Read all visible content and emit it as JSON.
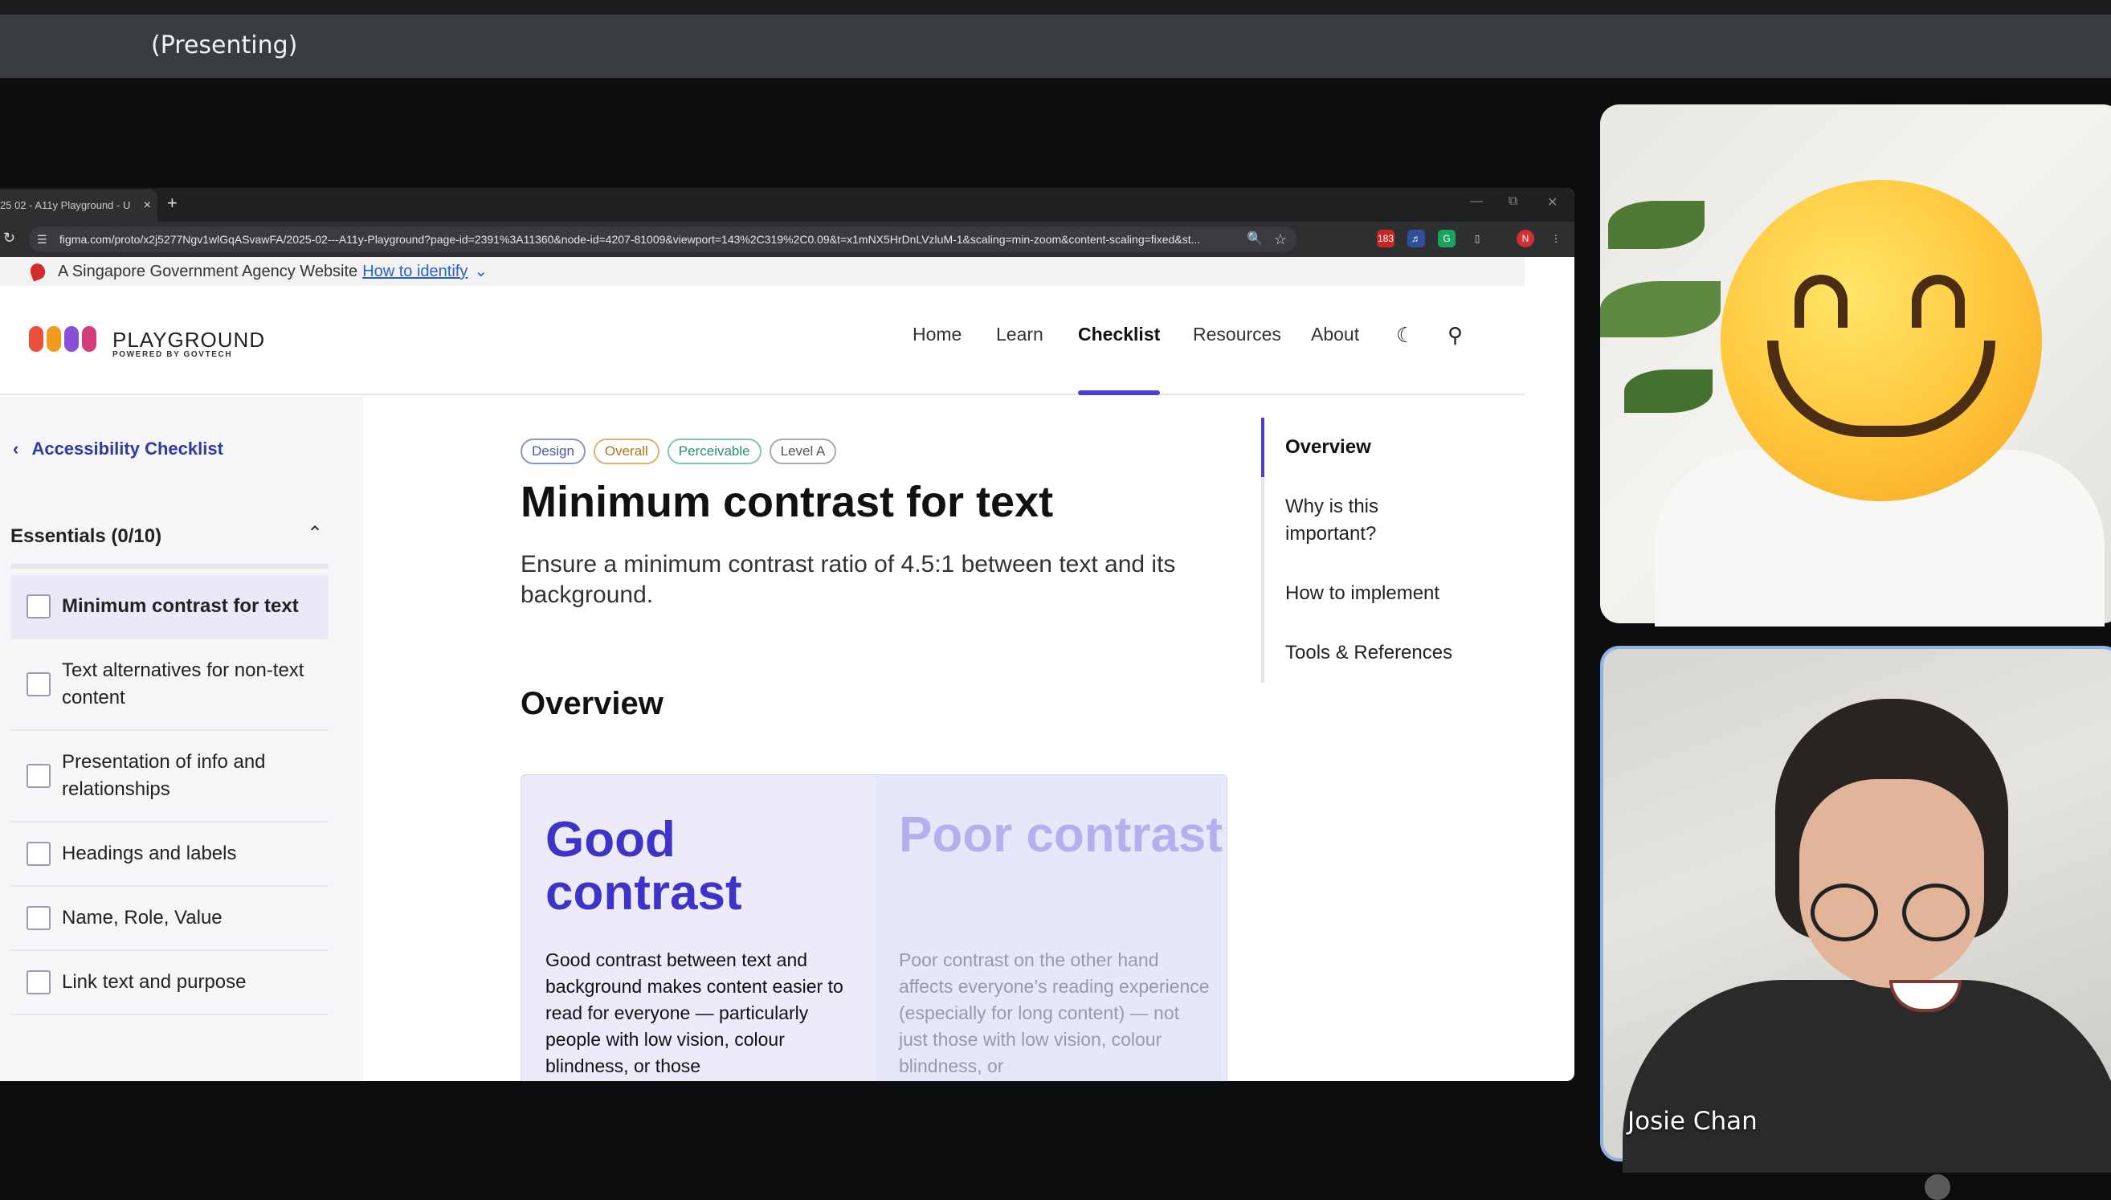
{
  "meeting": {
    "presenting_label": "(Presenting)",
    "participant_name": "Josie Chan"
  },
  "browser": {
    "tab_title": "25 02 - A11y Playground - U",
    "tab_close": "×",
    "new_tab": "+",
    "url": "figma.com/proto/x2j5277Ngv1wlGqASvawFA/2025-02---A11y-Playground?page-id=2391%3A11360&node-id=4207-81009&viewport=143%2C319%2C0.09&t=x1mNX5HrDnLVzluM-1&scaling=min-zoom&content-scaling=fixed&st...",
    "ext_badge": "183",
    "profile_initial": "N"
  },
  "site": {
    "gov_banner": {
      "text": "A Singapore Government Agency Website",
      "link": "How to identify"
    },
    "logo": {
      "title": "PLAYGROUND",
      "subtitle": "POWERED BY GOVTECH"
    },
    "nav": [
      "Home",
      "Learn",
      "Checklist",
      "Resources",
      "About"
    ],
    "active_nav": "Checklist",
    "sidebar": {
      "back_link": "Accessibility Checklist",
      "section_title": "Essentials (0/10)",
      "items": [
        "Minimum contrast for text",
        "Text alternatives for non-text content",
        "Presentation of info and relationships",
        "Headings and labels",
        "Name, Role, Value",
        "Link text and purpose"
      ]
    },
    "main": {
      "tags": [
        "Design",
        "Overall",
        "Perceivable",
        "Level A"
      ],
      "title": "Minimum contrast for text",
      "description": "Ensure a minimum contrast ratio of 4.5:1 between text and its background.",
      "overview_heading": "Overview",
      "good": {
        "heading": "Good contrast",
        "body": "Good contrast between text and background makes content easier to read for everyone — particularly people with low vision, colour blindness, or those"
      },
      "poor": {
        "heading": "Poor contrast",
        "body": "Poor contrast on the other hand affects everyone’s reading experience (especially for long content) — not just those with low vision, colour blindness, or"
      }
    },
    "toc": [
      "Overview",
      "Why is this important?",
      "How to implement",
      "Tools & References"
    ]
  },
  "colors": {
    "accent": "#4a3fd0",
    "tag_design": "#4a5a9a",
    "tag_overall": "#c8882a",
    "tag_perceivable": "#2e8f6f",
    "tag_level": "#6b6b6b"
  },
  "icons": [
    "reload-icon",
    "site-settings-icon",
    "zoom-icon",
    "star-icon",
    "extensions-icon",
    "menu-icon",
    "moon-icon",
    "search-icon",
    "chevron-left-icon",
    "chevron-up-icon",
    "chevron-down-icon",
    "flag-icon"
  ]
}
